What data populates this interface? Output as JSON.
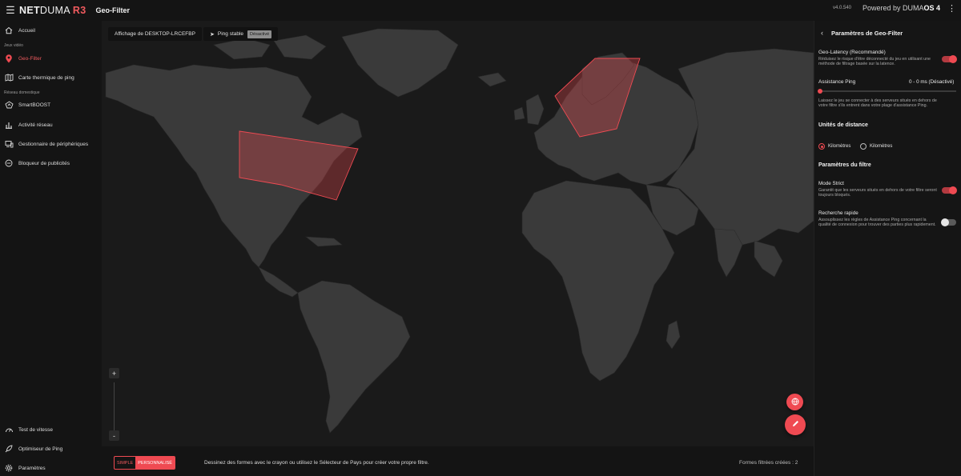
{
  "header": {
    "brand_part1": "NET",
    "brand_part2": "DUMA",
    "brand_model": "R3",
    "page_title": "Geo-Filter",
    "version": "v4.0.540",
    "powered_by": "Powered by DUMA",
    "powered_os": "OS 4"
  },
  "sidebar": {
    "items": [
      {
        "label": "Accueil",
        "icon": "home-icon"
      },
      {
        "label": "Geo-Filter",
        "icon": "map-pin-icon",
        "active": true
      },
      {
        "label": "Carte thermique de ping",
        "icon": "heatmap-icon"
      },
      {
        "label": "SmartBOOST",
        "icon": "boost-icon"
      },
      {
        "label": "Activité réseau",
        "icon": "bar-chart-icon"
      },
      {
        "label": "Gestionnaire de périphériques",
        "icon": "devices-icon"
      },
      {
        "label": "Bloqueur de publicités",
        "icon": "block-icon"
      },
      {
        "label": "Test de vitesse",
        "icon": "speedometer-icon"
      },
      {
        "label": "Optimiseur de Ping",
        "icon": "rocket-icon"
      },
      {
        "label": "Paramètres",
        "icon": "gear-icon"
      }
    ],
    "section_games": "Jeux vidéo",
    "section_home": "Réseau domestique"
  },
  "map": {
    "device_chip": "Affichage de DESKTOP-LRCEFBP",
    "ping_label": "Ping stable",
    "ping_status": "Désactivé",
    "zoom_in": "+",
    "zoom_out": "-",
    "accent": "#ef4a52"
  },
  "bottom": {
    "mode_simple": "SIMPLE",
    "mode_custom": "PERSONNALISÉ",
    "hint": "Dessinez des formes avec le crayon ou utilisez le Sélecteur de Pays pour créer votre propre filtre.",
    "count": "Formes filtrées créées : 2"
  },
  "panel": {
    "title": "Paramètres de Geo-Filter",
    "geo_latency_label": "Geo-Latency (Recommandé)",
    "geo_latency_desc": "Réduisez le risque d'être déconnecté du jeu en utilisant une méthode de filtrage basée sur la latence.",
    "geo_latency_on": true,
    "ping_assist_label": "Assistance Ping",
    "ping_assist_value": "0 - 0 ms  (Désactivé)",
    "ping_assist_desc": "Laissez le jeu se connecter à des serveurs situés en dehors de votre filtre s'ils entrent dans votre plage d'assistance Ping.",
    "units_title": "Unités de distance",
    "unit_km": "Kilomètres",
    "unit_mi": "Kilomètres",
    "filter_title": "Paramètres du filtre",
    "strict_label": "Mode Strict",
    "strict_desc": "Garantit que les serveurs situés en dehors de votre filtre seront toujours bloqués.",
    "strict_on": true,
    "fast_label": "Recherche rapide",
    "fast_desc": "Assouplissez les règles de Assistance Ping concernant la qualité de connexion pour trouver des parties plus rapidement.",
    "fast_on": false
  }
}
